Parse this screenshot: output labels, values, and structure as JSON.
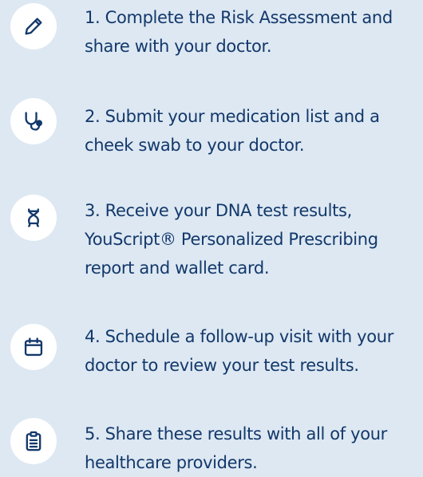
{
  "colors": {
    "background": "#dde8f2",
    "icon_background": "#ffffff",
    "text": "#13386b"
  },
  "steps": [
    {
      "icon": "pencil-icon",
      "line1": "1. Complete the Risk Assessment and",
      "line2": "share with your doctor."
    },
    {
      "icon": "stethoscope-icon",
      "line1": "2. Submit your medication list and a",
      "line2": "cheek swab to your doctor."
    },
    {
      "icon": "dna-icon",
      "line1": "3. Receive your DNA test results,",
      "line2": "YouScript® Personalized Prescribing",
      "line3": "report and wallet card."
    },
    {
      "icon": "calendar-icon",
      "line1": "4. Schedule a follow-up visit with your",
      "line2": "doctor to review your test results."
    },
    {
      "icon": "clipboard-icon",
      "line1": "5. Share these results with all of your",
      "line2": "healthcare providers."
    }
  ]
}
